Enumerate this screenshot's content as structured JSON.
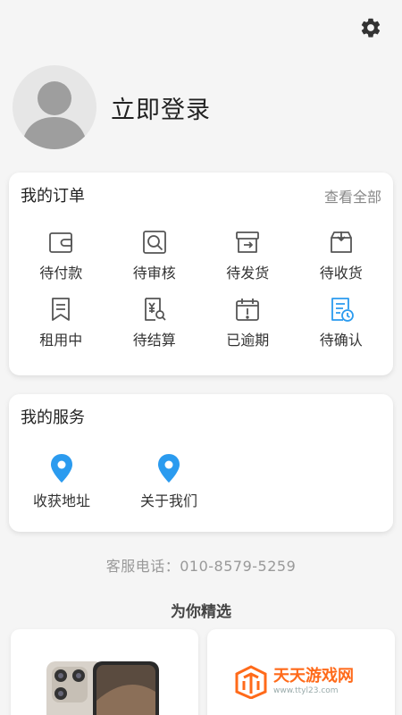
{
  "header": {
    "settings_icon": "gear-icon"
  },
  "profile": {
    "avatar_icon": "avatar-placeholder",
    "login_label": "立即登录"
  },
  "orders": {
    "title": "我的订单",
    "view_all": "查看全部",
    "items": [
      {
        "label": "待付款",
        "icon": "wallet-icon"
      },
      {
        "label": "待审核",
        "icon": "review-icon"
      },
      {
        "label": "待发货",
        "icon": "ship-box-icon"
      },
      {
        "label": "待收货",
        "icon": "receive-box-icon"
      },
      {
        "label": "租用中",
        "icon": "bookmark-icon"
      },
      {
        "label": "待结算",
        "icon": "bill-search-icon"
      },
      {
        "label": "已逾期",
        "icon": "calendar-alert-icon"
      },
      {
        "label": "待确认",
        "icon": "doc-clock-icon"
      }
    ]
  },
  "services": {
    "title": "我的服务",
    "items": [
      {
        "label": "收获地址",
        "icon": "location-pin-icon"
      },
      {
        "label": "关于我们",
        "icon": "location-pin-icon"
      }
    ]
  },
  "hotline": "客服电话：010-8579-5259",
  "picks": {
    "title": "为你精选"
  },
  "watermark": {
    "line1": "天天游戏网",
    "line2": "www.ttyl23.com"
  },
  "colors": {
    "accent_blue": "#2b9bef",
    "icon_gray": "#555555",
    "watermark_orange": "#ff6a1a"
  }
}
